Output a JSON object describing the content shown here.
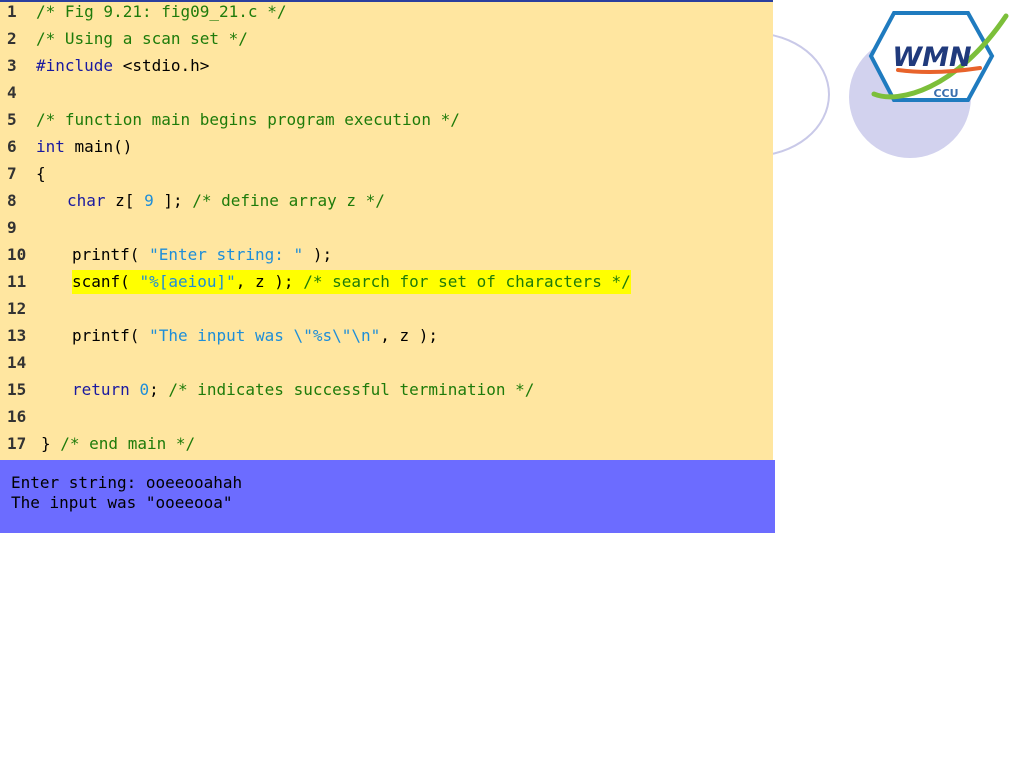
{
  "colors": {
    "panel_background": "#FFE6A0",
    "console_background": "#6C6CFF",
    "comment": "#1E7B0A",
    "keyword": "#1A1AA0",
    "literal": "#1E8ED8",
    "plain": "#000000",
    "highlight": "#FFFF00"
  },
  "logo": {
    "top_text": "WMN",
    "bottom_text": "CCU"
  },
  "code": {
    "lines": [
      {
        "n": "1",
        "tokens": [
          {
            "t": "/* Fig 9.21: fig09_21.c */",
            "c": "comment"
          }
        ]
      },
      {
        "n": "2",
        "tokens": [
          {
            "t": "/* Using a scan set */",
            "c": "comment"
          }
        ]
      },
      {
        "n": "3",
        "tokens": [
          {
            "t": "#include",
            "c": "keyword"
          },
          {
            "t": " <stdio.h>",
            "c": "plain"
          }
        ]
      },
      {
        "n": "4",
        "tokens": []
      },
      {
        "n": "5",
        "tokens": [
          {
            "t": "/* function main begins program execution */",
            "c": "comment"
          }
        ]
      },
      {
        "n": "6",
        "tokens": [
          {
            "t": "int",
            "c": "keyword"
          },
          {
            "t": " main()",
            "c": "plain"
          }
        ]
      },
      {
        "n": "7",
        "tokens": [
          {
            "t": "{",
            "c": "plain"
          }
        ]
      },
      {
        "n": "8",
        "tokens": [
          {
            "t": "char",
            "c": "keyword"
          },
          {
            "t": " z[ ",
            "c": "plain"
          },
          {
            "t": "9",
            "c": "literal"
          },
          {
            "t": " ]; ",
            "c": "plain"
          },
          {
            "t": "/* define array z */",
            "c": "comment"
          }
        ]
      },
      {
        "n": "9",
        "tokens": []
      },
      {
        "n": "10",
        "tokens": [
          {
            "t": "printf( ",
            "c": "plain"
          },
          {
            "t": "\"Enter string: \"",
            "c": "literal"
          },
          {
            "t": " );",
            "c": "plain"
          }
        ]
      },
      {
        "n": "11",
        "tokens": [
          {
            "t": "scanf( ",
            "c": "plain"
          },
          {
            "t": "\"%[aeiou]\"",
            "c": "literal"
          },
          {
            "t": ", z ); ",
            "c": "plain"
          },
          {
            "t": "/* search for set of characters */",
            "c": "comment"
          }
        ]
      },
      {
        "n": "12",
        "tokens": []
      },
      {
        "n": "13",
        "tokens": [
          {
            "t": "printf( ",
            "c": "plain"
          },
          {
            "t": "\"The input was \\\"%s\\\"\\n\"",
            "c": "literal"
          },
          {
            "t": ", z );",
            "c": "plain"
          }
        ]
      },
      {
        "n": "14",
        "tokens": []
      },
      {
        "n": "15",
        "tokens": [
          {
            "t": "return",
            "c": "keyword"
          },
          {
            "t": " ",
            "c": "plain"
          },
          {
            "t": "0",
            "c": "literal"
          },
          {
            "t": "; ",
            "c": "plain"
          },
          {
            "t": "/* indicates successful termination */",
            "c": "comment"
          }
        ]
      },
      {
        "n": "16",
        "tokens": []
      },
      {
        "n": "17",
        "tokens": [
          {
            "t": "} ",
            "c": "plain"
          },
          {
            "t": "/* end main */",
            "c": "comment"
          }
        ]
      }
    ]
  },
  "output": {
    "lines": [
      "Enter string: ooeeooahah",
      "The input was \"ooeeooa\""
    ]
  }
}
